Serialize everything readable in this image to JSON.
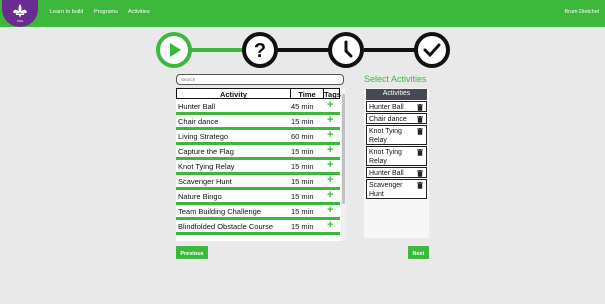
{
  "nav": {
    "logo_text": "ПЭН",
    "links": [
      "Learn to build",
      "Programs",
      "Activities"
    ],
    "user": "Brum Dietchel"
  },
  "steps": [
    {
      "icon": "play-icon",
      "state": "active"
    },
    {
      "icon": "question-icon",
      "state": "pending"
    },
    {
      "icon": "clock-icon",
      "state": "pending"
    },
    {
      "icon": "check-icon",
      "state": "pending"
    }
  ],
  "search": {
    "placeholder": "Search"
  },
  "table": {
    "headers": [
      "Activity",
      "Time",
      "Tags"
    ],
    "add_symbol": "+",
    "rows": [
      {
        "name": "Hunter Ball",
        "time": "45 min"
      },
      {
        "name": "Chair dance",
        "time": "15 min"
      },
      {
        "name": "Living Stratego",
        "time": "60 min"
      },
      {
        "name": "Capture the Flag",
        "time": "15 min"
      },
      {
        "name": "Knot Tying Relay",
        "time": "15 min"
      },
      {
        "name": "Scavenger Hunt",
        "time": "15 min"
      },
      {
        "name": "Nature Bingo",
        "time": "15 min"
      },
      {
        "name": "Team Building Challenge",
        "time": "15 min"
      },
      {
        "name": "Blindfolded Obstacle Course",
        "time": "15 min"
      }
    ]
  },
  "selected": {
    "title": "Select Activities",
    "header": "Activities",
    "items": [
      "Hunter Ball",
      "Chair dance",
      "Knot Tying Relay",
      "Knot Tying Relay",
      "Hunter Ball",
      "Scavenger Hunt"
    ]
  },
  "buttons": {
    "previous": "Previous",
    "next": "Next"
  },
  "colors": {
    "accent": "#3cb83c",
    "brand": "#6a2c91",
    "panel_header": "#454a52"
  }
}
